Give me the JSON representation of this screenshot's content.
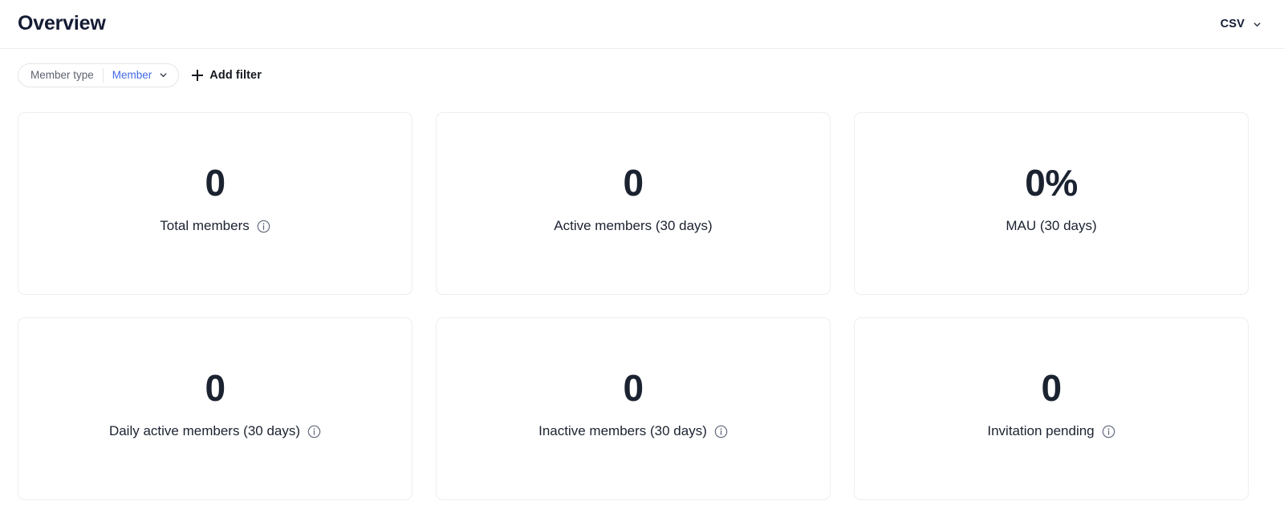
{
  "header": {
    "title": "Overview",
    "export": {
      "label": "CSV",
      "chevron_icon": "chevron-down-icon"
    }
  },
  "filters": {
    "pill": {
      "key": "Member type",
      "value": "Member",
      "chevron_icon": "chevron-down-icon"
    },
    "add_filter": {
      "label": "Add filter",
      "icon": "plus-icon"
    }
  },
  "cards": [
    {
      "value": "0",
      "label": "Total members",
      "has_info": true,
      "info_icon": "info-circle-icon"
    },
    {
      "value": "0",
      "label": "Active members (30 days)",
      "has_info": false,
      "info_icon": ""
    },
    {
      "value": "0%",
      "label": "MAU (30 days)",
      "has_info": false,
      "info_icon": ""
    },
    {
      "value": "0",
      "label": "Daily active members (30 days)",
      "has_info": true,
      "info_icon": "info-circle-icon"
    },
    {
      "value": "0",
      "label": "Inactive members (30 days)",
      "has_info": true,
      "info_icon": "info-circle-icon"
    },
    {
      "value": "0",
      "label": "Invitation pending",
      "has_info": true,
      "info_icon": "info-circle-icon"
    }
  ],
  "colors": {
    "text_primary": "#1b2230",
    "text_muted": "#5c6370",
    "accent_blue": "#4069e5",
    "border": "#eceef2",
    "info_icon": "#5b6478"
  }
}
